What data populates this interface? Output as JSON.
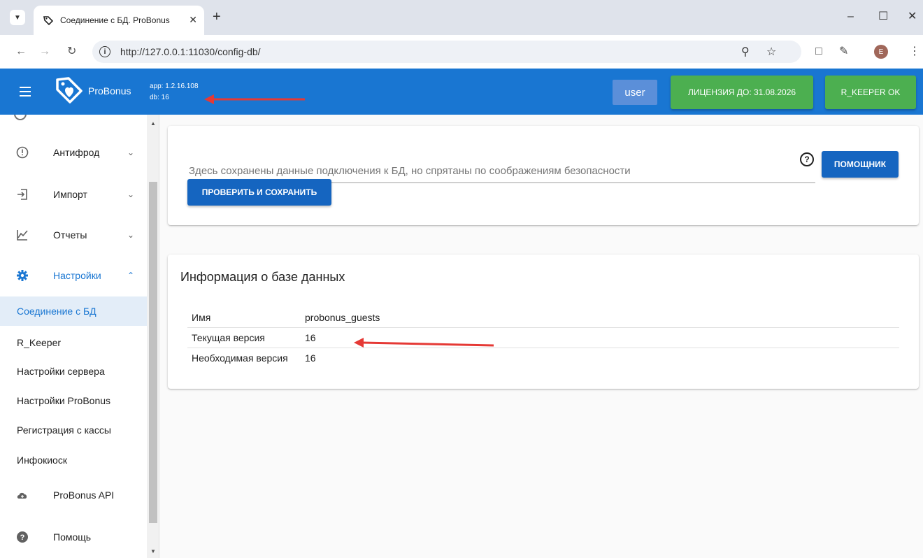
{
  "browser": {
    "tab_title": "Соединение с БД. ProBonus",
    "url": "http://127.0.0.1:11030/config-db/",
    "profile_initial": "E"
  },
  "header": {
    "brand": "ProBonus",
    "app_version": "app: 1.2.16.108",
    "db_version": "db: 16",
    "user_label": "user",
    "license_label": "ЛИЦЕНЗИЯ ДО: 31.08.2026",
    "rkeeper_label": "R_KEEPER OK"
  },
  "sidebar": {
    "items": [
      {
        "label": "Антифрод",
        "icon": "alert-circle-icon"
      },
      {
        "label": "Импорт",
        "icon": "import-icon"
      },
      {
        "label": "Отчеты",
        "icon": "chart-icon"
      },
      {
        "label": "Настройки",
        "icon": "gear-icon"
      }
    ],
    "subitems": [
      "Соединение с БД",
      "R_Keeper",
      "Настройки сервера",
      "Настройки ProBonus",
      "Регистрация с кассы",
      "Инфокиоск"
    ],
    "bottom_items": [
      {
        "label": "ProBonus API",
        "icon": "cloud-icon"
      },
      {
        "label": "Помощь",
        "icon": "help-icon"
      }
    ]
  },
  "connection": {
    "placeholder": "Здесь сохранены данные подключения к БД, но спрятаны по соображениям безопасности",
    "assistant_button": "ПОМОЩНИК",
    "check_save_button": "ПРОВЕРИТЬ И СОХРАНИТЬ"
  },
  "db_info": {
    "title": "Информация о базе данных",
    "rows": [
      {
        "key": "Имя",
        "value": "probonus_guests"
      },
      {
        "key": "Текущая версия",
        "value": "16"
      },
      {
        "key": "Необходимая версия",
        "value": "16"
      }
    ]
  },
  "colors": {
    "primary": "#1976d2",
    "success": "#4caf50",
    "button_blue": "#1565c0",
    "annotation_red": "#e53935"
  }
}
